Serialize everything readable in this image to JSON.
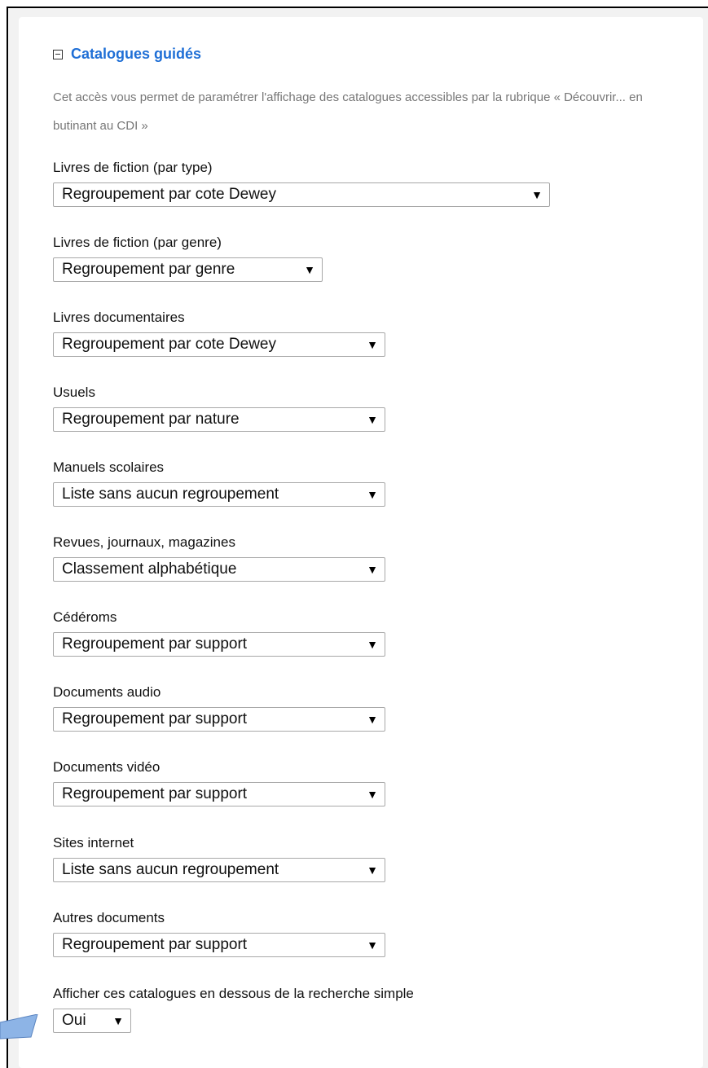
{
  "section": {
    "title": "Catalogues guidés",
    "description": "Cet accès vous permet de paramétrer l'affichage des catalogues accessibles par la rubrique « Découvrir... en butinant au CDI »"
  },
  "fields": [
    {
      "label": "Livres de fiction (par type)",
      "value": "Regroupement par cote Dewey"
    },
    {
      "label": "Livres de fiction (par genre)",
      "value": "Regroupement par genre"
    },
    {
      "label": "Livres documentaires",
      "value": "Regroupement par cote Dewey"
    },
    {
      "label": "Usuels",
      "value": "Regroupement par nature"
    },
    {
      "label": "Manuels scolaires",
      "value": "Liste sans aucun regroupement"
    },
    {
      "label": "Revues, journaux, magazines",
      "value": "Classement alphabétique"
    },
    {
      "label": "Cédéroms",
      "value": "Regroupement par support"
    },
    {
      "label": "Documents audio",
      "value": "Regroupement par support"
    },
    {
      "label": "Documents vidéo",
      "value": "Regroupement par support"
    },
    {
      "label": "Sites internet",
      "value": "Liste sans aucun regroupement"
    },
    {
      "label": "Autres documents",
      "value": "Regroupement par support"
    },
    {
      "label": "Afficher ces catalogues en dessous de la recherche simple",
      "value": "Oui"
    }
  ],
  "icons": {
    "collapse": "collapse-minus-icon",
    "dropdown": "dropdown-arrow-icon",
    "callout": "callout-pointer"
  },
  "colors": {
    "title": "#1f6fd6",
    "description": "#777777",
    "callout_fill": "#8db4e6"
  }
}
